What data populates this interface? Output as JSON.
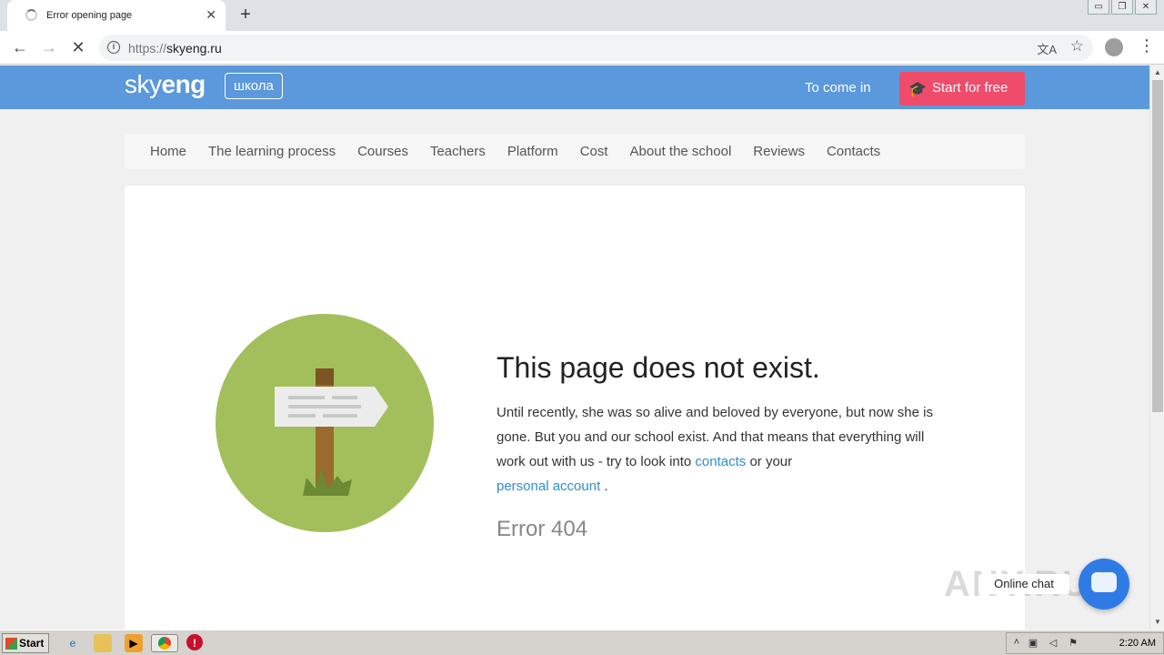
{
  "browser": {
    "tab_title": "Error opening page",
    "tab_close": "✕",
    "new_tab": "+",
    "url_scheme": "https://",
    "url_host": "skyeng.ru",
    "window_buttons": [
      "▭",
      "❐",
      "✕"
    ]
  },
  "site": {
    "logo_sky": "sky",
    "logo_eng": "eng",
    "school_badge": "школа",
    "login": "To come in",
    "start_button": "Start for free",
    "nav": [
      "Home",
      "The learning process",
      "Courses",
      "Teachers",
      "Platform",
      "Cost",
      "About the school",
      "Reviews",
      "Contacts"
    ]
  },
  "error": {
    "headline": "This page does not exist.",
    "desc_part1": "Until recently, she was so alive and beloved by everyone, but now she is gone. But you and our school exist. And that means that everything will work out with us - try to look into ",
    "contacts_link": "contacts",
    "desc_part2": " or your ",
    "account_link": "personal account",
    "desc_part3": " .",
    "code": "Error 404"
  },
  "chat": {
    "label": "Online chat"
  },
  "watermark": "ANY.RUN",
  "taskbar": {
    "start": "Start",
    "clock": "2:20 AM"
  },
  "colors": {
    "header": "#5b98dc",
    "cta": "#ef4b6b",
    "link": "#2d8ecf",
    "illustration": "#a3bf5c"
  }
}
